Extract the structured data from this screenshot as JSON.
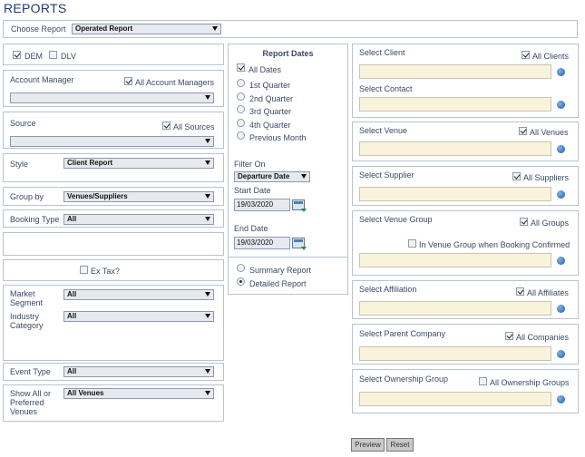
{
  "page": {
    "title": "REPORTS"
  },
  "choose_report": {
    "label": "Choose Report",
    "value": "Operated Report"
  },
  "left": {
    "dem_label": "DEM",
    "dlv_label": "DLV",
    "account_manager": {
      "label": "Account Manager",
      "all_label": "All Account Managers",
      "value": ""
    },
    "source": {
      "label": "Source",
      "all_label": "All Sources",
      "value": ""
    },
    "style": {
      "label": "Style",
      "value": "Client Report"
    },
    "group_by": {
      "label": "Group by",
      "value": "Venues/Suppliers"
    },
    "booking_type": {
      "label": "Booking Type",
      "value": "All"
    },
    "ex_tax_label": "Ex Tax?",
    "market_segment": {
      "label_1": "Market",
      "label_2": "Segment",
      "value": "All"
    },
    "industry_category": {
      "label_1": "Industry",
      "label_2": "Category",
      "value": "All"
    },
    "event_type": {
      "label": "Event Type",
      "value": "All"
    },
    "show_all": {
      "label_1": "Show All or",
      "label_2": "Preferred",
      "label_3": "Venues",
      "value": "All Venues"
    }
  },
  "middle": {
    "report_dates_title": "Report Dates",
    "all_dates_label": "All Dates",
    "quarters": [
      "1st Quarter",
      "2nd Quarter",
      "3rd Quarter",
      "4th Quarter",
      "Previous Month"
    ],
    "filter_on_label": "Filter On",
    "filter_on_value": "Departure Date",
    "start_date_label": "Start Date",
    "start_date_value": "19/03/2020",
    "end_date_label": "End Date",
    "end_date_value": "19/03/2020",
    "summary_label": "Summary Report",
    "detailed_label": "Detailed Report"
  },
  "right": {
    "client": {
      "label": "Select Client",
      "all_label": "All Clients"
    },
    "contact": {
      "label": "Select Contact"
    },
    "venue": {
      "label": "Select Venue",
      "all_label": "All Venues"
    },
    "supplier": {
      "label": "Select Supplier",
      "all_label": "All Suppliers"
    },
    "venue_group": {
      "label": "Select Venue Group",
      "all_label": "All Groups",
      "extra_label": "In Venue Group when Booking Confirmed"
    },
    "affiliation": {
      "label": "Select Affiliation",
      "all_label": "All Affiliates"
    },
    "parent_company": {
      "label": "Select Parent Company",
      "all_label": "All Companies"
    },
    "ownership_group": {
      "label": "Select Ownership Group",
      "all_label": "All Ownership Groups"
    }
  },
  "buttons": {
    "preview": "Preview",
    "reset": "Reset"
  }
}
